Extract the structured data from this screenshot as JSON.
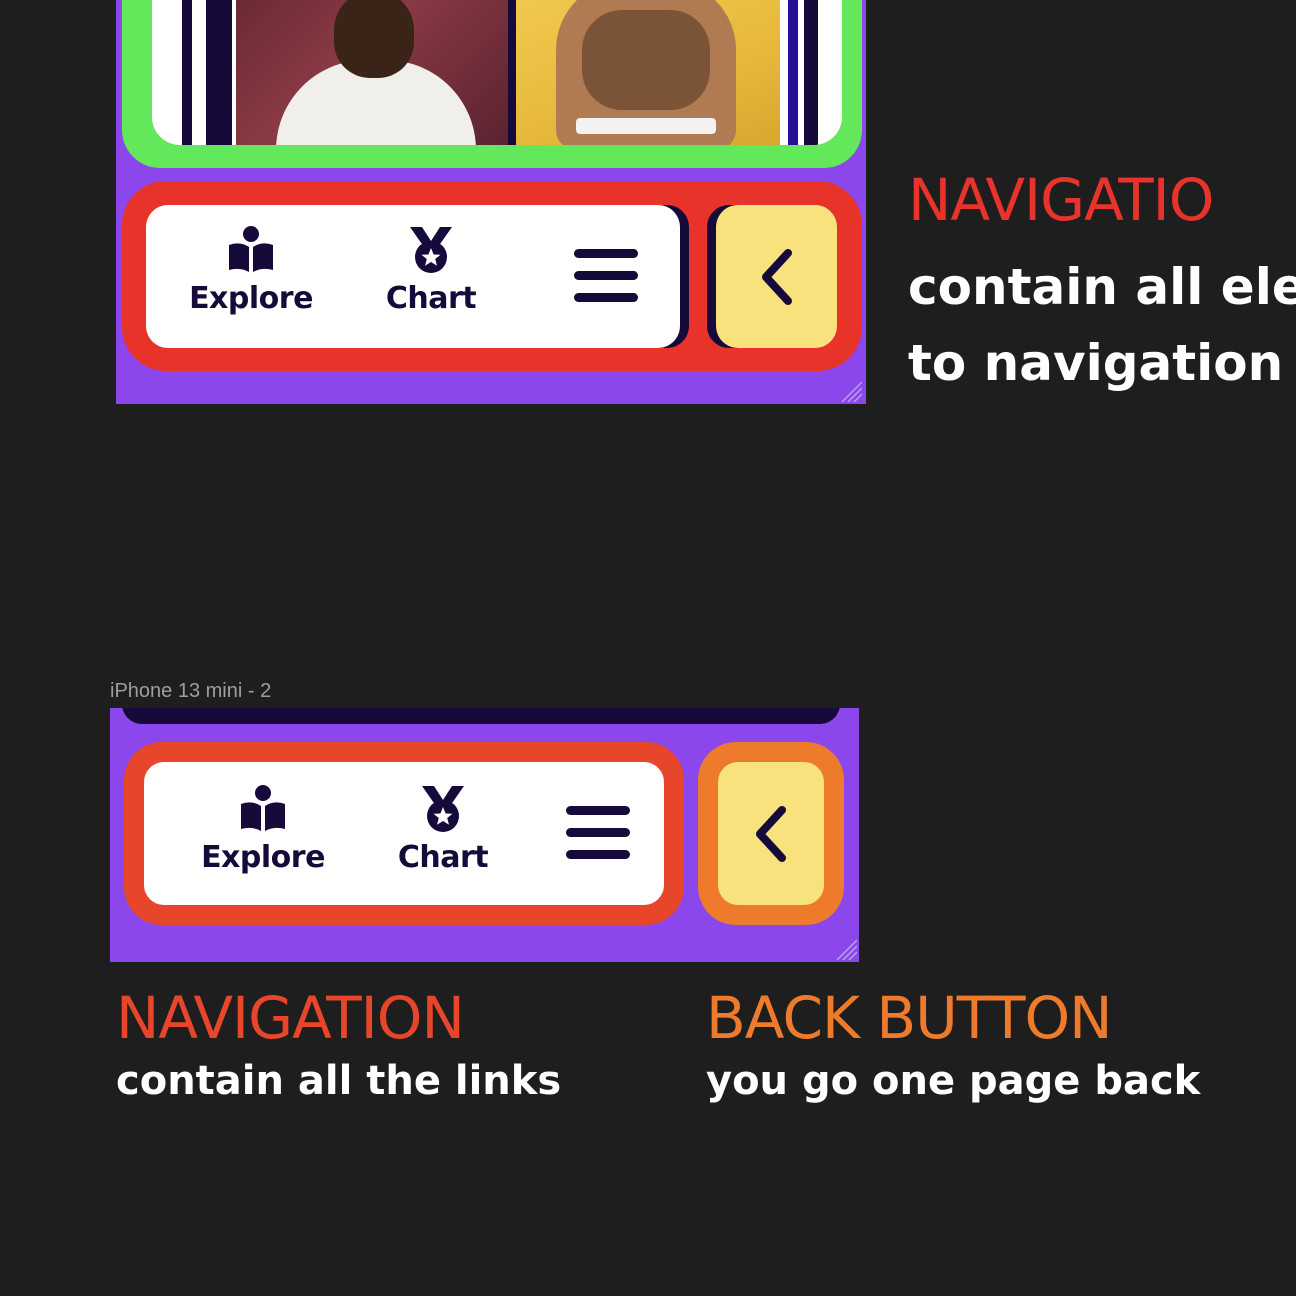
{
  "frame_label": "iPhone 13 mini - 2",
  "nav": {
    "explore_label": "Explore",
    "chart_label": "Chart"
  },
  "annotations": {
    "top": {
      "title": "NAVIGATIO",
      "line1": "contain all ele",
      "line2": "to navigation"
    },
    "navigation": {
      "title": "NAVIGATION",
      "subtitle": "contain all the links"
    },
    "back_button": {
      "title": "BACK BUTTON",
      "subtitle": "you go one page back"
    }
  },
  "colors": {
    "canvas": "#1e1e1e",
    "frame_purple": "#8b46ec",
    "outline_green": "#62e85a",
    "outline_red": "#e8332a",
    "outline_orange": "#ee7b2c",
    "back_yellow": "#f8e27e",
    "ink": "#150a3a"
  },
  "icons": [
    "explore-book-icon",
    "chart-medal-icon",
    "menu-hamburger-icon",
    "back-chevron-icon"
  ]
}
